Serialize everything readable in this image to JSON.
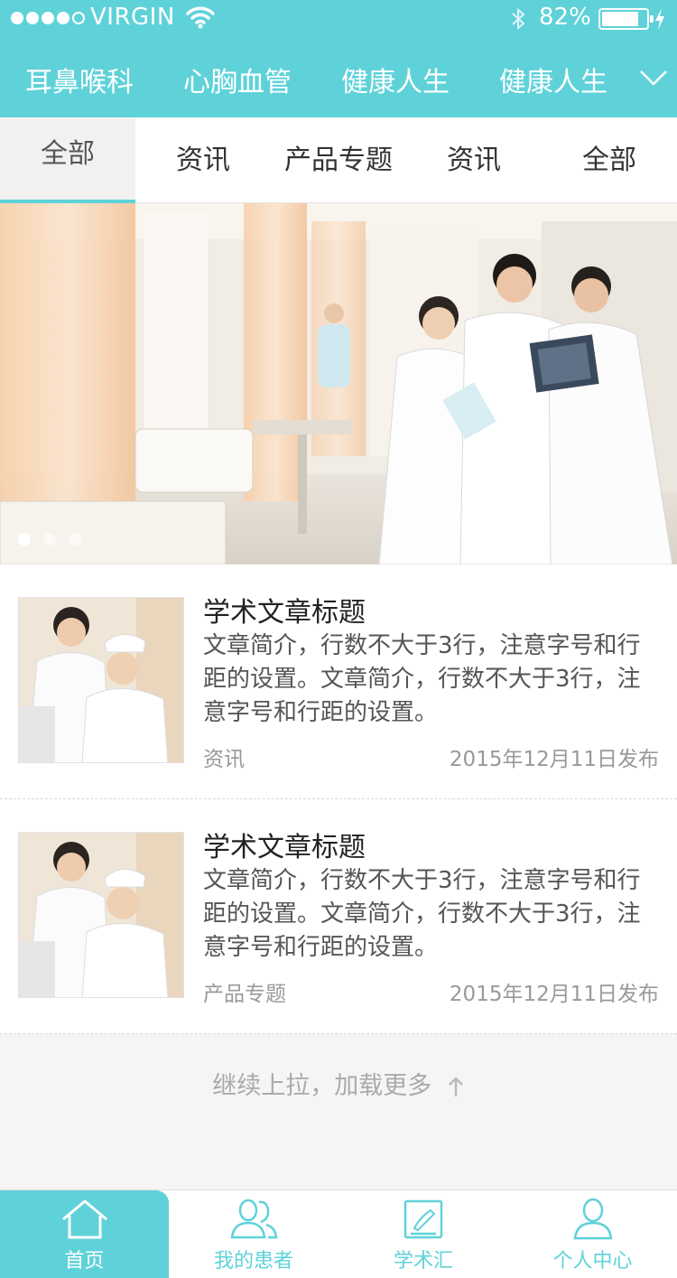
{
  "status": {
    "carrier": "VIRGIN",
    "battery_pct": "82%",
    "signal_bars": 4,
    "signal_total": 5
  },
  "category_nav": {
    "items": [
      "耳鼻喉科",
      "心胸血管",
      "健康人生",
      "健康人生"
    ],
    "expand_icon": "chevron-down-icon"
  },
  "tabs": {
    "items": [
      "全部",
      "资讯",
      "产品专题",
      "资讯",
      "全部"
    ],
    "active_index": 0
  },
  "banner": {
    "page_count": 3,
    "active_page": 0
  },
  "articles": [
    {
      "title": "学术文章标题",
      "desc": "文章简介，行数不大于3行，注意字号和行距的设置。文章简介，行数不大于3行，注意字号和行距的设置。",
      "tag": "资讯",
      "date": "2015年12月11日发布"
    },
    {
      "title": "学术文章标题",
      "desc": "文章简介，行数不大于3行，注意字号和行距的设置。文章简介，行数不大于3行，注意字号和行距的设置。",
      "tag": "产品专题",
      "date": "2015年12月11日发布"
    }
  ],
  "load_more": {
    "text": "继续上拉，加载更多"
  },
  "tabbar": {
    "items": [
      {
        "label": "首页",
        "icon": "home-icon"
      },
      {
        "label": "我的患者",
        "icon": "patients-icon"
      },
      {
        "label": "学术汇",
        "icon": "academic-icon"
      },
      {
        "label": "个人中心",
        "icon": "profile-icon"
      }
    ],
    "active_index": 0
  },
  "colors": {
    "accent": "#5fd2d9",
    "text_dark": "#222222",
    "text_muted": "#999999"
  }
}
